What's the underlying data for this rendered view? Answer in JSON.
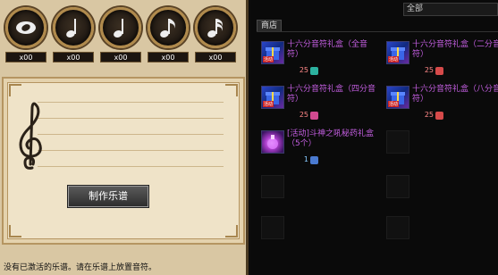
{
  "note_buttons": [
    {
      "icon": "whole-note-icon",
      "count": "x00"
    },
    {
      "icon": "quarter-note-icon",
      "count": "x00"
    },
    {
      "icon": "quarter-note-icon",
      "count": "x00"
    },
    {
      "icon": "eighth-note-icon",
      "count": "x00"
    },
    {
      "icon": "sixteenth-note-icon",
      "count": "x00"
    }
  ],
  "score": {
    "make_button": "制作乐谱",
    "status_text": "没有已激活的乐谱。请在乐谱上放置音符。"
  },
  "store": {
    "filter_value": "全部",
    "tab_label": "商店",
    "items": [
      {
        "name": "十六分音符礼盒（全音符）",
        "qty": "25",
        "icon": "gift-box-icon"
      },
      {
        "name": "十六分音符礼盒（二分音符）",
        "qty": "25",
        "icon": "gift-box-icon"
      },
      {
        "name": "十六分音符礼盒（四分音符）",
        "qty": "25",
        "icon": "gift-box-icon"
      },
      {
        "name": "十六分音符礼盒（八分音符）",
        "qty": "25",
        "icon": "gift-box-icon"
      },
      {
        "name": "[活动]斗神之吼秘药礼盒（5个）",
        "qty": "1",
        "icon": "potion-box-icon"
      }
    ]
  },
  "colors": {
    "item_name": "#c35ee0",
    "parchment": "#efe3c8",
    "frame_gold": "#b59561"
  }
}
